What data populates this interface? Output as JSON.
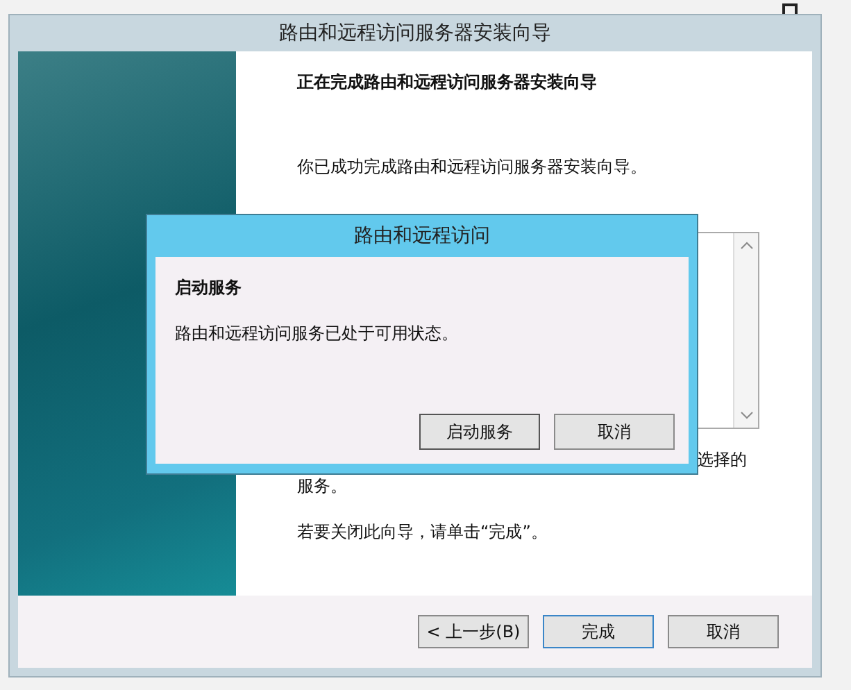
{
  "wizard": {
    "title": "路由和远程访问服务器安装向导",
    "heading": "正在完成路由和远程访问服务器安装向导",
    "message": "你已成功完成路由和远程访问服务器安装向导。",
    "partial_line": "选择的",
    "partial_line_2": "服务。",
    "close_hint": "若要关闭此向导，请单击“完成”。",
    "buttons": [
      {
        "label": "< 上一步(B)",
        "default": false
      },
      {
        "label": "完成",
        "default": true
      },
      {
        "label": "取消",
        "default": false
      }
    ]
  },
  "dialog": {
    "title": "路由和远程访问",
    "heading": "启动服务",
    "message": "路由和远程访问服务已处于可用状态。",
    "buttons": [
      {
        "label": "启动服务",
        "default": true
      },
      {
        "label": "取消",
        "default": false
      }
    ]
  }
}
